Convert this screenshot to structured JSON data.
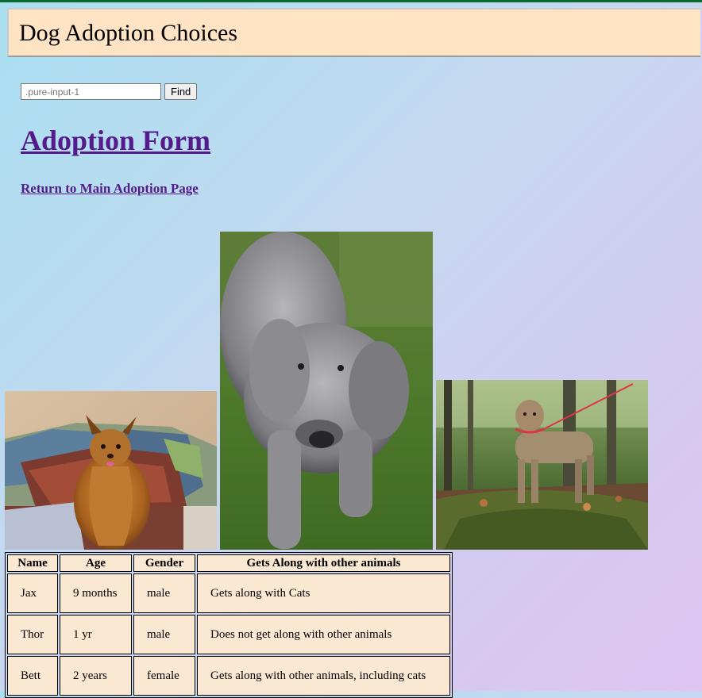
{
  "header": {
    "title": "Dog Adoption Choices"
  },
  "search": {
    "placeholder": ".pure-input-1",
    "button_label": "Find"
  },
  "main": {
    "heading": "Adoption Form",
    "return_link": "Return to Main Adoption Page"
  },
  "photos": [
    {
      "subject": "yorkshire terrier on couch"
    },
    {
      "subject": "grey curly poodle on grass"
    },
    {
      "subject": "terrier on mossy rock in forest"
    }
  ],
  "table": {
    "headers": [
      "Name",
      "Age",
      "Gender",
      "Gets Along with other animals"
    ],
    "rows": [
      [
        "Jax",
        "9 months",
        "male",
        "Gets along with Cats"
      ],
      [
        "Thor",
        "1 yr",
        "male",
        "Does not get along with other animals"
      ],
      [
        "Bett",
        "2 years",
        "female",
        "Gets along with other animals, including cats"
      ]
    ]
  },
  "colors": {
    "header_bg": "#fee4c4",
    "link": "#551a8b",
    "cell_bg": "#fbe8d3",
    "top_accent": "#0a6b2e"
  }
}
